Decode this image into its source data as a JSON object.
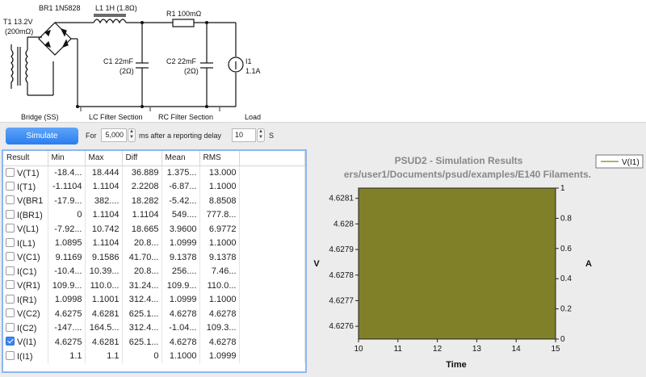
{
  "schematic": {
    "transformer_label": "T1 13.2V",
    "transformer_resistance": "(200mΩ)",
    "rectifier_label": "BR1 1N5828",
    "inductor_label": "L1 1H (1.8Ω)",
    "resistor_label": "R1 100mΩ",
    "cap1_label": "C1 22mF",
    "cap1_esr": "(2Ω)",
    "cap2_label": "C2 22mF",
    "cap2_esr": "(2Ω)",
    "load_label": "I1",
    "load_value": "1.1A",
    "section_bridge": "Bridge (SS)",
    "section_lc": "LC Filter Section",
    "section_rc": "RC Filter Section",
    "section_load": "Load"
  },
  "toolbar": {
    "simulate_label": "Simulate",
    "for_label": "For",
    "duration_value": "5,000",
    "after_label": "ms after a reporting delay",
    "delay_value": "10",
    "delay_unit": "S"
  },
  "table": {
    "headers": [
      "Result",
      "Min",
      "Max",
      "Diff",
      "Mean",
      "RMS"
    ],
    "rows": [
      {
        "name": "V(T1)",
        "checked": false,
        "min": "-18.4...",
        "max": "18.444",
        "diff": "36.889",
        "mean": "1.375...",
        "rms": "13.000"
      },
      {
        "name": "I(T1)",
        "checked": false,
        "min": "-1.1104",
        "max": "1.1104",
        "diff": "2.2208",
        "mean": "-6.87...",
        "rms": "1.1000"
      },
      {
        "name": "V(BR1",
        "checked": false,
        "min": "-17.9...",
        "max": "382....",
        "diff": "18.282",
        "mean": "-5.42...",
        "rms": "8.8508"
      },
      {
        "name": "I(BR1)",
        "checked": false,
        "min": "0",
        "max": "1.1104",
        "diff": "1.1104",
        "mean": "549....",
        "rms": "777.8..."
      },
      {
        "name": "V(L1)",
        "checked": false,
        "min": "-7.92...",
        "max": "10.742",
        "diff": "18.665",
        "mean": "3.9600",
        "rms": "6.9772"
      },
      {
        "name": "I(L1)",
        "checked": false,
        "min": "1.0895",
        "max": "1.1104",
        "diff": "20.8...",
        "mean": "1.0999",
        "rms": "1.1000"
      },
      {
        "name": "V(C1)",
        "checked": false,
        "min": "9.1169",
        "max": "9.1586",
        "diff": "41.70...",
        "mean": "9.1378",
        "rms": "9.1378"
      },
      {
        "name": "I(C1)",
        "checked": false,
        "min": "-10.4...",
        "max": "10.39...",
        "diff": "20.8...",
        "mean": "256....",
        "rms": "7.46..."
      },
      {
        "name": "V(R1)",
        "checked": false,
        "min": "109.9...",
        "max": "110.0...",
        "diff": "31.24...",
        "mean": "109.9...",
        "rms": "110.0..."
      },
      {
        "name": "I(R1)",
        "checked": false,
        "min": "1.0998",
        "max": "1.1001",
        "diff": "312.4...",
        "mean": "1.0999",
        "rms": "1.1000"
      },
      {
        "name": "V(C2)",
        "checked": false,
        "min": "4.6275",
        "max": "4.6281",
        "diff": "625.1...",
        "mean": "4.6278",
        "rms": "4.6278"
      },
      {
        "name": "I(C2)",
        "checked": false,
        "min": "-147....",
        "max": "164.5...",
        "diff": "312.4...",
        "mean": "-1.04...",
        "rms": "109.3..."
      },
      {
        "name": "V(I1)",
        "checked": true,
        "min": "4.6275",
        "max": "4.6281",
        "diff": "625.1...",
        "mean": "4.6278",
        "rms": "4.6278"
      },
      {
        "name": "I(I1)",
        "checked": false,
        "min": "1.1",
        "max": "1.1",
        "diff": "0",
        "mean": "1.1000",
        "rms": "1.0999"
      }
    ]
  },
  "chart_data": {
    "type": "area",
    "title": "PSUD2 - Simulation Results",
    "subtitle": "ers/user1/Documents/psud/examples/E140 Filaments.",
    "xlabel": "Time",
    "ylabel": "V",
    "y2label": "A",
    "xlim": [
      10,
      15
    ],
    "ylim": [
      4.62755,
      4.62814
    ],
    "y2lim": [
      0,
      1
    ],
    "x_ticks": [
      "10",
      "11",
      "12",
      "13",
      "14",
      "15"
    ],
    "y_ticks": [
      "4.6276",
      "4.6277",
      "4.6278",
      "4.6279",
      "4.628",
      "4.6281"
    ],
    "y2_ticks": [
      "0",
      "0.2",
      "0.4",
      "0.6",
      "0.8",
      "1"
    ],
    "legend_position": "top-right",
    "series": [
      {
        "name": "V(I1)",
        "color": "#808028",
        "x": [
          10,
          15
        ],
        "y_min": [
          4.62755,
          4.62755
        ],
        "y_max": [
          4.62814,
          4.62814
        ]
      }
    ]
  },
  "colors": {
    "accent": "#2a7ef0",
    "series": "#808028",
    "table_border": "#8cb7f3"
  }
}
